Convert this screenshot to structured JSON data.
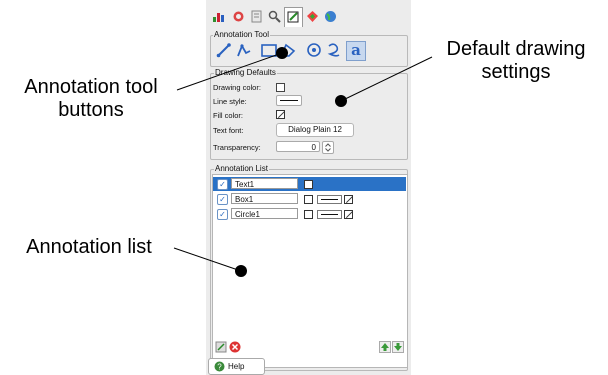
{
  "top_tabs": [
    "chart-icon",
    "gear-icon",
    "document-icon",
    "search-icon",
    "annotation-icon",
    "palette-icon",
    "globe-icon"
  ],
  "annotation_tool": {
    "title": "Annotation Tool",
    "tools": [
      "line-tool-icon",
      "polyline-tool-icon",
      "box-tool-icon",
      "polygon-tool-icon",
      "circle-tool-icon",
      "freehand-tool-icon",
      "text-tool-icon"
    ]
  },
  "drawing_defaults": {
    "title": "Drawing Defaults",
    "drawing_color_label": "Drawing color:",
    "line_style_label": "Line style:",
    "fill_color_label": "Fill color:",
    "text_font_label": "Text font:",
    "text_font_value": "Dialog Plain 12",
    "transparency_label": "Transparency:",
    "transparency_value": "0"
  },
  "annotation_list": {
    "title": "Annotation List",
    "rows": [
      {
        "name": "Text1",
        "checked": true,
        "selected": true
      },
      {
        "name": "Box1",
        "checked": true,
        "selected": false
      },
      {
        "name": "Circle1",
        "checked": true,
        "selected": false
      }
    ]
  },
  "help_label": "Help",
  "callouts": {
    "tool_buttons": "Annotation tool buttons",
    "defaults": "Default drawing settings",
    "list": "Annotation list"
  }
}
